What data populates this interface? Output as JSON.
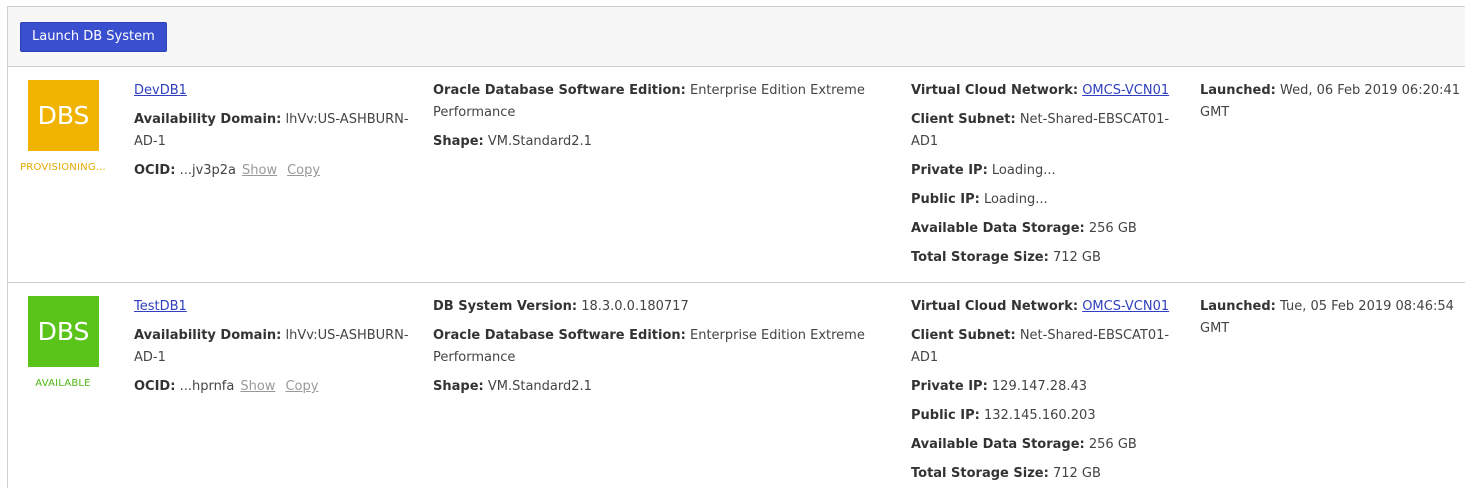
{
  "toolbar": {
    "launch_label": "Launch DB System"
  },
  "colors": {
    "provisioning": "#f0b400",
    "available": "#5bc41a",
    "button": "#3a4fd0",
    "link": "#2f3fbf"
  },
  "labels": {
    "availability_domain": "Availability Domain:",
    "ocid": "OCID:",
    "show": "Show",
    "copy": "Copy",
    "db_system_version": "DB System Version:",
    "software_edition": "Oracle Database Software Edition:",
    "shape": "Shape:",
    "vcn": "Virtual Cloud Network:",
    "client_subnet": "Client Subnet:",
    "private_ip": "Private IP:",
    "public_ip": "Public IP:",
    "available_storage": "Available Data Storage:",
    "total_storage": "Total Storage Size:",
    "launched": "Launched:"
  },
  "systems": [
    {
      "icon_text": "DBS",
      "state": "PROVISIONING...",
      "name": "DevDB1",
      "availability_domain": "lhVv:US-ASHBURN-AD-1",
      "ocid": "...jv3p2a",
      "software_edition": "Enterprise Edition Extreme Performance",
      "shape": "VM.Standard2.1",
      "vcn": "OMCS-VCN01",
      "client_subnet": "Net-Shared-EBSCAT01-AD1",
      "private_ip": "Loading...",
      "public_ip": "Loading...",
      "available_storage": "256 GB",
      "total_storage": "712 GB",
      "launched": "Wed, 06 Feb 2019 06:20:41 GMT"
    },
    {
      "icon_text": "DBS",
      "state": "AVAILABLE",
      "name": "TestDB1",
      "availability_domain": "lhVv:US-ASHBURN-AD-1",
      "ocid": "...hprnfa",
      "db_system_version": "18.3.0.0.180717",
      "software_edition": "Enterprise Edition Extreme Performance",
      "shape": "VM.Standard2.1",
      "vcn": "OMCS-VCN01",
      "client_subnet": "Net-Shared-EBSCAT01-AD1",
      "private_ip": "129.147.28.43",
      "public_ip": "132.145.160.203",
      "available_storage": "256 GB",
      "total_storage": "712 GB",
      "launched": "Tue, 05 Feb 2019 08:46:54 GMT"
    }
  ]
}
